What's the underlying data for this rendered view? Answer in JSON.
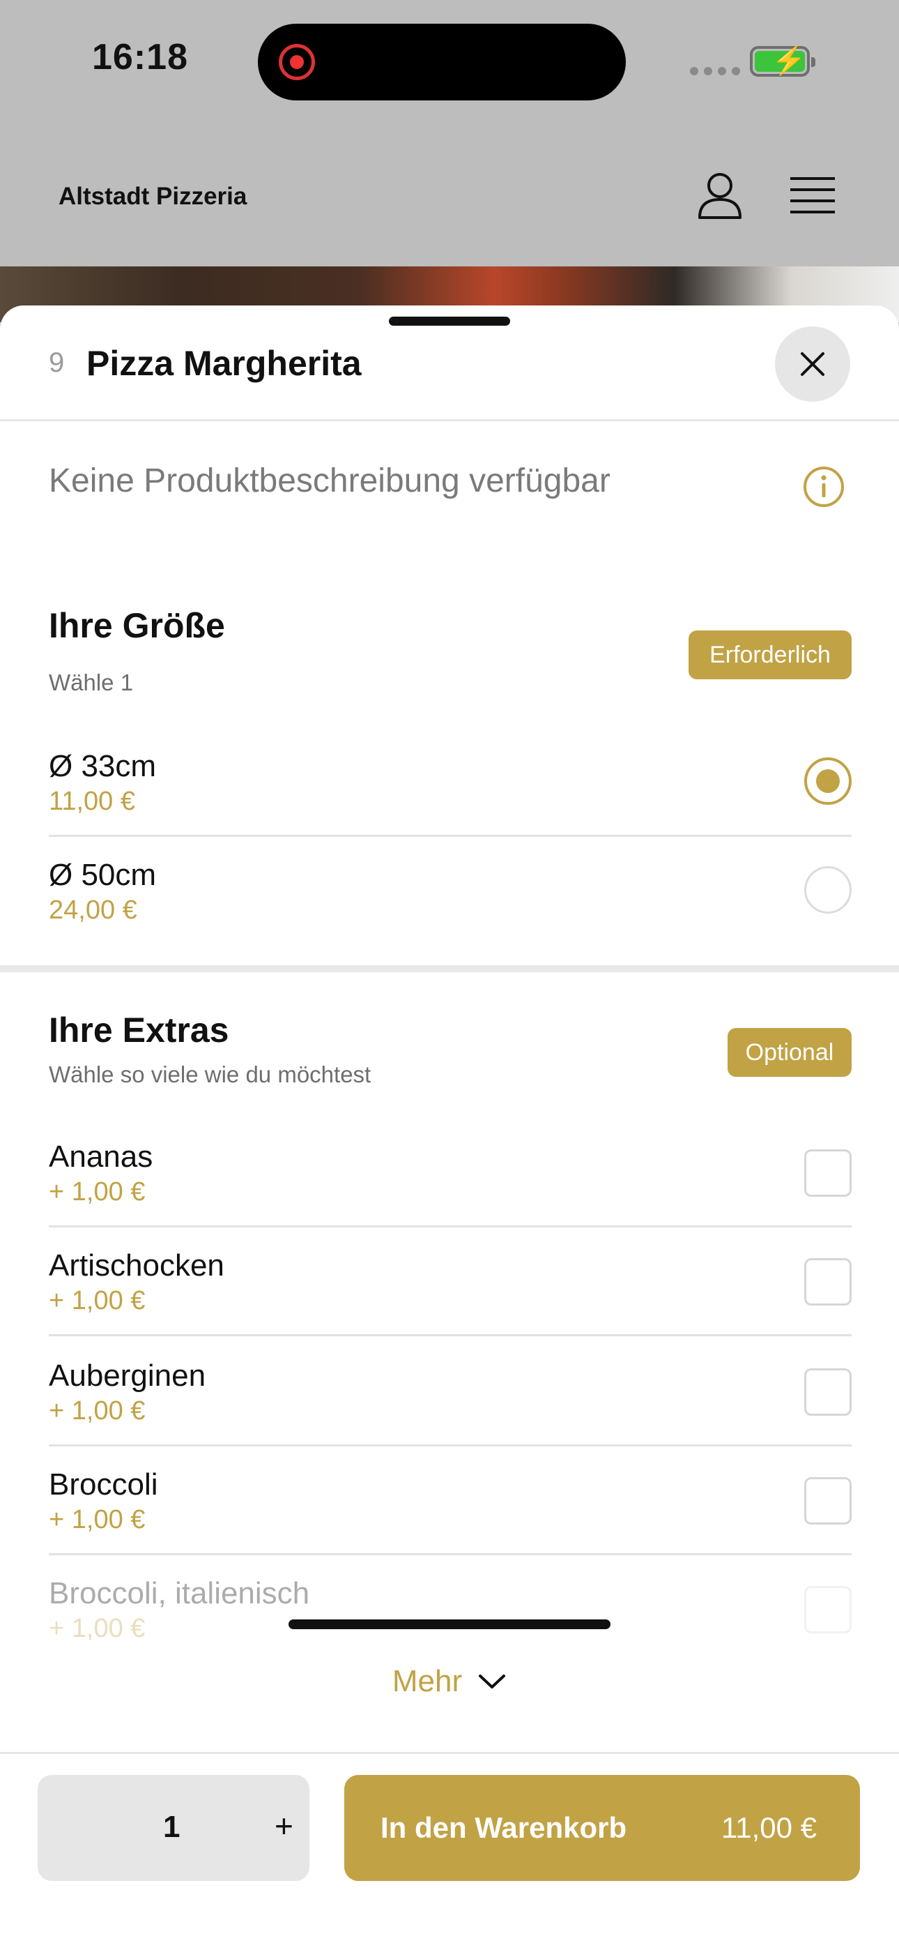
{
  "status_bar": {
    "time": "16:18"
  },
  "header": {
    "brand": "Altstadt Pizzeria",
    "icons": [
      "user-icon",
      "menu-icon"
    ]
  },
  "product": {
    "number": "9",
    "title": "Pizza Margherita",
    "description": "Keine Produktbeschreibung verfügbar"
  },
  "size_section": {
    "title": "Ihre Größe",
    "subtitle": "Wähle 1",
    "badge": "Erforderlich",
    "options": [
      {
        "name": "Ø 33cm",
        "price": "11,00 €",
        "selected": true
      },
      {
        "name": "Ø 50cm",
        "price": "24,00 €",
        "selected": false
      }
    ]
  },
  "extras_section": {
    "title": "Ihre Extras",
    "subtitle": "Wähle so viele wie du möchtest",
    "badge": "Optional",
    "options": [
      {
        "name": "Ananas",
        "price": "+ 1,00 €",
        "checked": false
      },
      {
        "name": "Artischocken",
        "price": "+ 1,00 €",
        "checked": false
      },
      {
        "name": "Auberginen",
        "price": "+ 1,00 €",
        "checked": false
      },
      {
        "name": "Broccoli",
        "price": "+ 1,00 €",
        "checked": false
      },
      {
        "name": "Broccoli, italienisch",
        "price": "+ 1,00 €",
        "checked": false
      }
    ],
    "more_label": "Mehr"
  },
  "footer": {
    "quantity": "1",
    "plus": "+",
    "cart_label": "In den Warenkorb",
    "cart_price": "11,00 €"
  },
  "colors": {
    "accent": "#c1a245",
    "background": "#bdbdbd"
  }
}
